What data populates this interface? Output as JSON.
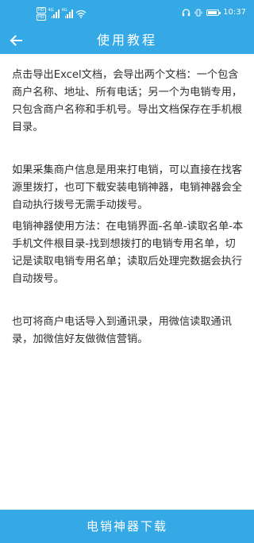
{
  "status_bar": {
    "sim1_badge_top": "HD",
    "sim1_badge_bottom": "HD",
    "sim1_network": "4G",
    "sim2_network": "4G",
    "battery_level": "93",
    "time": "10:37"
  },
  "nav": {
    "title": "使用教程",
    "back_icon": "arrow-left-icon"
  },
  "content": {
    "paragraphs": [
      "点击导出Excel文档，会导出两个文档：一个包含商户名称、地址、所有电话；另一个为电销专用，只包含商户名称和手机号。导出文档保存在手机根目录。",
      "如果采集商户信息是用来打电销，可以直接在找客源里拨打，也可下载安装电销神器，电销神器会全自动执行拨号无需手动拨号。",
      "电销神器使用方法：在电销界面-名单-读取名单-本手机文件根目录-找到想拨打的电销专用名单，切记是读取电销专用名单；读取后处理完数据会执行自动拨号。",
      "也可将商户电话导入到通讯录，用微信读取通讯录，加微信好友做微信营销。"
    ]
  },
  "footer": {
    "download_label": "电销神器下载"
  },
  "colors": {
    "accent": "#35a9e6",
    "text": "#2f2f2f",
    "background": "#ffffff"
  }
}
